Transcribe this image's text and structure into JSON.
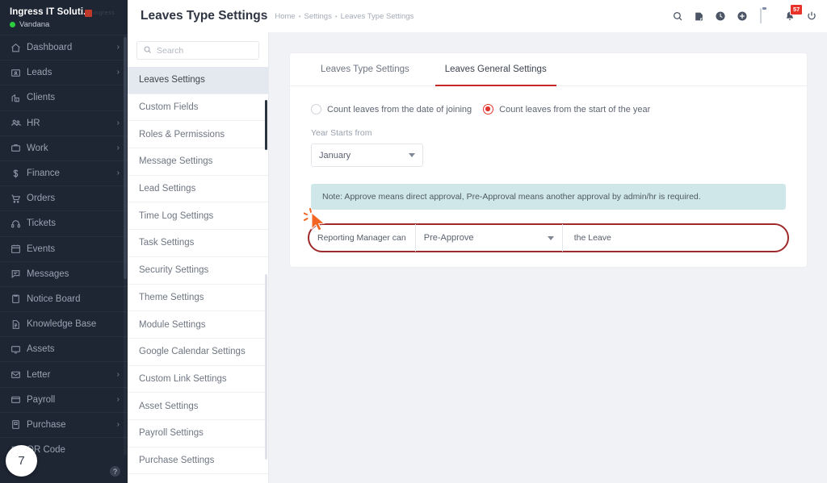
{
  "brand": {
    "company": "Ingress IT Soluti...",
    "user": "Vandana",
    "logo_text": "ingress",
    "status_color": "#2ecc40"
  },
  "sidebar": {
    "items": [
      {
        "label": "Dashboard",
        "icon": "home-icon",
        "has_chevron": true
      },
      {
        "label": "Leads",
        "icon": "leads-icon",
        "has_chevron": true
      },
      {
        "label": "Clients",
        "icon": "clients-icon",
        "has_chevron": false
      },
      {
        "label": "HR",
        "icon": "users-icon",
        "has_chevron": true
      },
      {
        "label": "Work",
        "icon": "briefcase-icon",
        "has_chevron": true
      },
      {
        "label": "Finance",
        "icon": "dollar-icon",
        "has_chevron": true
      },
      {
        "label": "Orders",
        "icon": "cart-icon",
        "has_chevron": false
      },
      {
        "label": "Tickets",
        "icon": "headset-icon",
        "has_chevron": false
      },
      {
        "label": "Events",
        "icon": "calendar-icon",
        "has_chevron": false
      },
      {
        "label": "Messages",
        "icon": "message-icon",
        "has_chevron": false
      },
      {
        "label": "Notice Board",
        "icon": "clipboard-icon",
        "has_chevron": false
      },
      {
        "label": "Knowledge Base",
        "icon": "document-icon",
        "has_chevron": false
      },
      {
        "label": "Assets",
        "icon": "monitor-icon",
        "has_chevron": false
      },
      {
        "label": "Letter",
        "icon": "envelope-icon",
        "has_chevron": true
      },
      {
        "label": "Payroll",
        "icon": "wallet-icon",
        "has_chevron": true
      },
      {
        "label": "Purchase",
        "icon": "purchase-icon",
        "has_chevron": true
      },
      {
        "label": "QR Code",
        "icon": "qr-icon",
        "has_chevron": false
      }
    ],
    "help_label": "?",
    "step_number": "7"
  },
  "topbar": {
    "title": "Leaves Type Settings",
    "breadcrumb": [
      "Home",
      "Settings",
      "Leaves Type Settings"
    ],
    "icons": [
      "search-icon",
      "note-icon",
      "clock-icon",
      "plus-circle-icon",
      "avatar",
      "bell-icon",
      "power-icon"
    ],
    "notification_count": "57",
    "badge_color": "#e8332a"
  },
  "settings_panel": {
    "search_placeholder": "Search",
    "search_value": "",
    "items": [
      {
        "label": "Leaves Settings",
        "active": true
      },
      {
        "label": "Custom Fields",
        "active": false
      },
      {
        "label": "Roles & Permissions",
        "active": false
      },
      {
        "label": "Message Settings",
        "active": false
      },
      {
        "label": "Lead Settings",
        "active": false
      },
      {
        "label": "Time Log Settings",
        "active": false
      },
      {
        "label": "Task Settings",
        "active": false
      },
      {
        "label": "Security Settings",
        "active": false
      },
      {
        "label": "Theme Settings",
        "active": false
      },
      {
        "label": "Module Settings",
        "active": false
      },
      {
        "label": "Google Calendar Settings",
        "active": false
      },
      {
        "label": "Custom Link Settings",
        "active": false
      },
      {
        "label": "Asset Settings",
        "active": false
      },
      {
        "label": "Payroll Settings",
        "active": false
      },
      {
        "label": "Purchase Settings",
        "active": false
      }
    ]
  },
  "main": {
    "tabs": [
      {
        "label": "Leaves Type Settings",
        "active": false
      },
      {
        "label": "Leaves General Settings",
        "active": true
      }
    ],
    "active_tab_color": "#c62828",
    "radio_options": [
      {
        "label": "Count leaves from the date of joining",
        "checked": false
      },
      {
        "label": "Count leaves from the start of the year",
        "checked": true
      }
    ],
    "radio_accent": "#e0332c",
    "year_starts_label": "Year Starts from",
    "year_starts_value": "January",
    "note_text": "Note: Approve means direct approval, Pre-Approval means another approval by admin/hr is required.",
    "note_bg": "#cfe7e9",
    "reporting_row": {
      "prefix": "Reporting Manager can",
      "select_value": "Pre-Approve",
      "suffix": "the Leave",
      "highlight_color": "#9e2a2b"
    }
  }
}
